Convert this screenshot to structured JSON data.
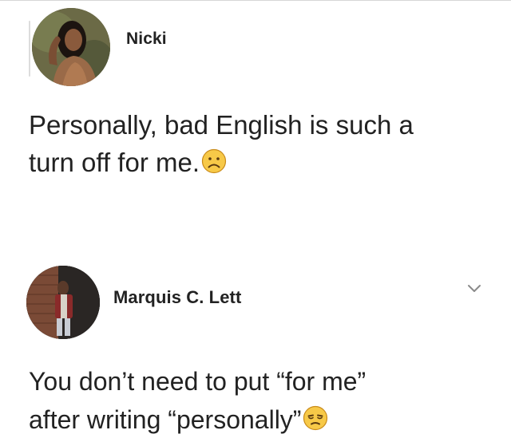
{
  "posts": [
    {
      "author": "Nicki",
      "avatar": "profile-photo-woman",
      "text": "Personally, bad English is such a",
      "text_line2": "turn off for me.",
      "emoji": "frowning-face"
    },
    {
      "author": "Marquis C. Lett",
      "avatar": "profile-photo-man",
      "text": "You don’t need to put “for me”",
      "text_line2": "after writing “personally”",
      "emoji": "unamused-face",
      "menu_icon": "chevron-down-icon"
    }
  ],
  "colors": {
    "text": "#222222",
    "emoji_fill": "#f7c948",
    "emoji_stroke": "#c98b1a",
    "border": "#d6d6d6"
  }
}
